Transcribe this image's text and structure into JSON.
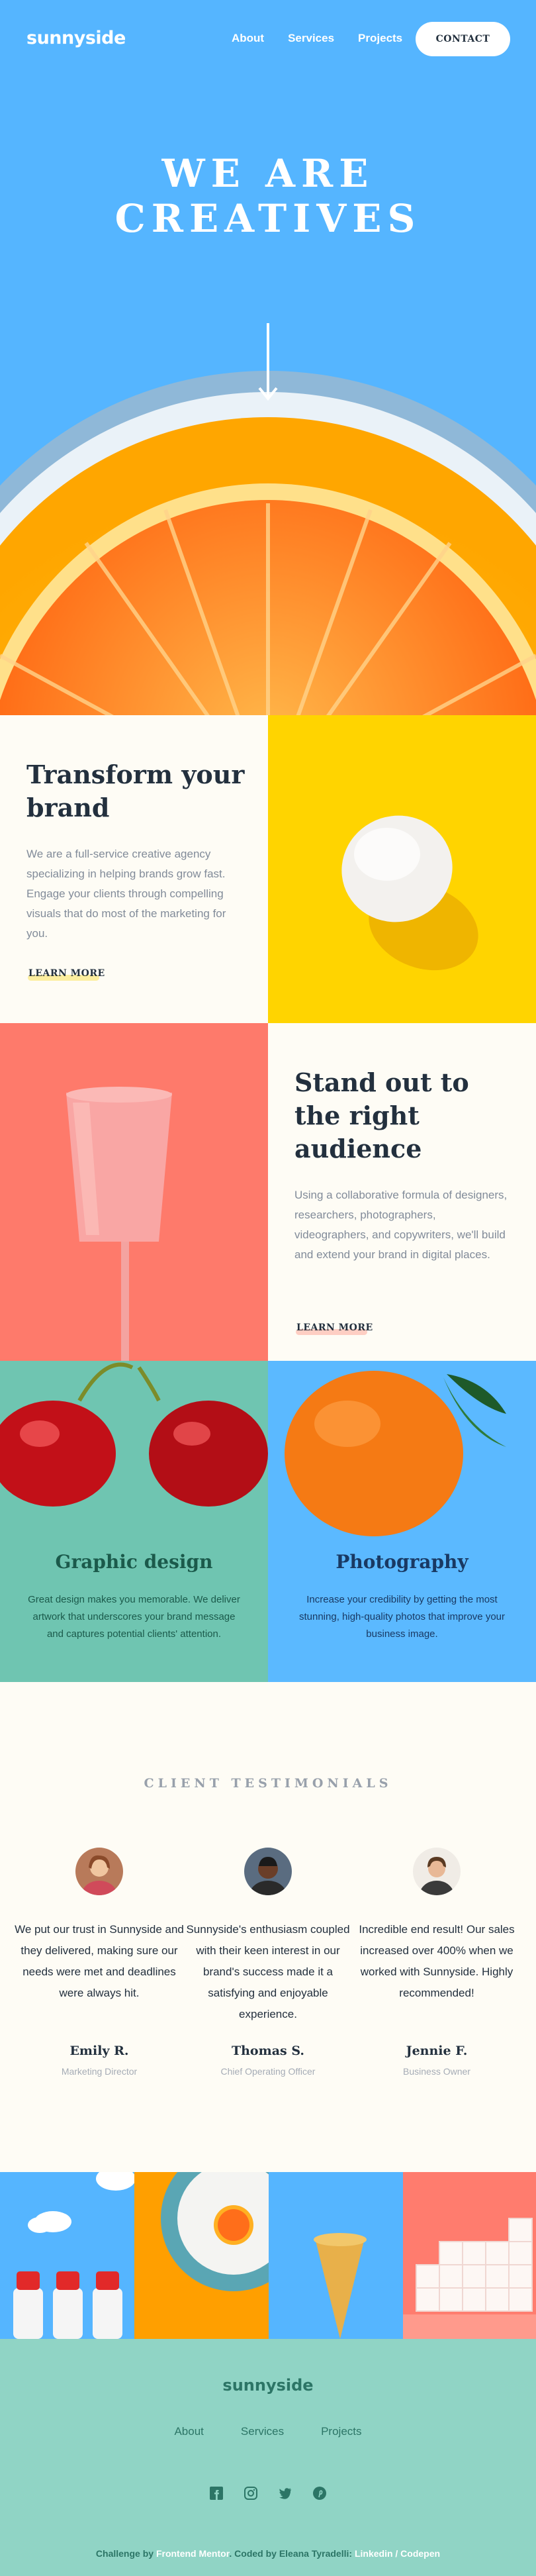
{
  "header": {
    "logo": "sunnyside",
    "nav": [
      "About",
      "Services",
      "Projects"
    ],
    "contact": "CONTACT"
  },
  "hero": {
    "title": "WE ARE CREATIVES"
  },
  "features": [
    {
      "title": "Transform your brand",
      "body": "We are a full-service creative agency specializing in helping brands grow fast. Engage your clients through compelling visuals that do most of the marketing for you.",
      "link": "LEARN MORE",
      "accent": "#fad400"
    },
    {
      "title": "Stand out to the right audience",
      "body": "Using a collaborative formula of designers, researchers, photographers, videographers, and copywriters, we'll build and extend your brand in digital places.",
      "link": "LEARN MORE",
      "accent": "#fe7766"
    }
  ],
  "services": [
    {
      "title": "Graphic design",
      "body": "Great design makes you memorable. We deliver artwork that underscores your brand message and captures potential clients' attention.",
      "color": "#1b5a4b"
    },
    {
      "title": "Photography",
      "body": "Increase your credibility by getting the most stunning, high-quality photos that improve your business image.",
      "color": "#193963"
    }
  ],
  "testimonials": {
    "heading": "CLIENT TESTIMONIALS",
    "items": [
      {
        "quote": "We put our trust in Sunnyside and they delivered, making sure our needs were met and deadlines were always hit.",
        "name": "Emily R.",
        "role": "Marketing Director"
      },
      {
        "quote": "Sunnyside's enthusiasm coupled with their keen interest in our brand's success made it a satisfying and enjoyable experience.",
        "name": "Thomas S.",
        "role": "Chief Operating Officer"
      },
      {
        "quote": "Incredible end result! Our sales increased over 400% when we worked with Sunnyside. Highly recommended!",
        "name": "Jennie F.",
        "role": "Business Owner"
      }
    ]
  },
  "footer": {
    "logo": "sunnyside",
    "links": [
      "About",
      "Services",
      "Projects"
    ],
    "social": [
      "facebook-icon",
      "instagram-icon",
      "twitter-icon",
      "pinterest-icon"
    ],
    "attr_prefix": "Challenge by",
    "attr_fm": "Frontend Mentor",
    "attr_mid": ". Coded by Eleana Tyradelli:",
    "attr_links": "Linkedin / Codepen"
  }
}
